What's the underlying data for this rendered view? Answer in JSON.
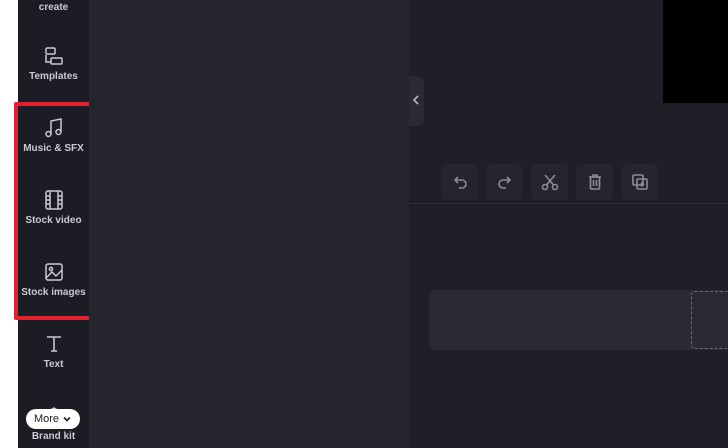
{
  "sidebar": {
    "items": [
      {
        "label": "Record &\ncreate",
        "icon": "record-icon"
      },
      {
        "label": "Templates",
        "icon": "templates-icon"
      },
      {
        "label": "Music & SFX",
        "icon": "music-icon"
      },
      {
        "label": "Stock video",
        "icon": "film-icon"
      },
      {
        "label": "Stock images",
        "icon": "image-icon"
      },
      {
        "label": "Text",
        "icon": "text-icon"
      },
      {
        "label": "Brand kit",
        "icon": "brand-kit-icon"
      }
    ],
    "more_label": "More"
  },
  "toolbar": {
    "buttons": [
      "undo-icon",
      "redo-icon",
      "split-icon",
      "delete-icon",
      "duplicate-icon"
    ]
  },
  "colors": {
    "sidebar_bg": "#1c1c24",
    "panel_bg": "#25252e",
    "main_bg": "#1f1f27",
    "highlight": "#e5202e",
    "text": "#c9c9d2"
  }
}
